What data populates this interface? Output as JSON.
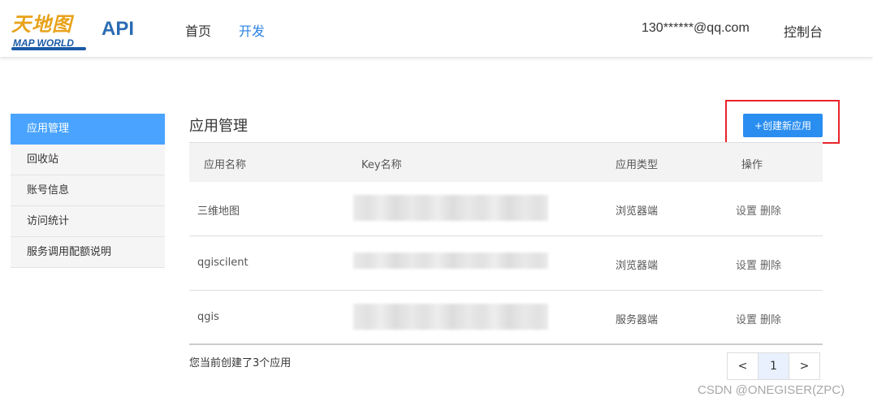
{
  "header": {
    "logo_cn": "天地图",
    "logo_en": "MAP WORLD",
    "api_label": "API",
    "nav": [
      {
        "label": "首页",
        "active": false
      },
      {
        "label": "开发",
        "active": true
      }
    ],
    "user_email": "130******@qq.com",
    "console_label": "控制台"
  },
  "sidebar": {
    "items": [
      {
        "label": "应用管理",
        "active": true
      },
      {
        "label": "回收站",
        "active": false
      },
      {
        "label": "账号信息",
        "active": false
      },
      {
        "label": "访问统计",
        "active": false
      },
      {
        "label": "服务调用配额说明",
        "active": false
      }
    ]
  },
  "main": {
    "title": "应用管理",
    "create_button": "+创建新应用",
    "table": {
      "headers": {
        "name": "应用名称",
        "key": "Key名称",
        "type": "应用类型",
        "ops": "操作"
      },
      "rows": [
        {
          "name": "三维地图",
          "type": "浏览器端",
          "op_settings": "设置",
          "op_delete": "删除"
        },
        {
          "name": "qgiscilent",
          "type": "浏览器端",
          "op_settings": "设置",
          "op_delete": "删除"
        },
        {
          "name": "qgis",
          "type": "服务器端",
          "op_settings": "设置",
          "op_delete": "删除"
        }
      ]
    },
    "summary": "您当前创建了3个应用",
    "pagination": {
      "prev": "<",
      "current": "1",
      "next": ">"
    }
  },
  "watermark": "CSDN @ONEGISER(ZPC)",
  "colors": {
    "accent": "#2a8ef0",
    "sidebar_active": "#4aa4ff",
    "highlight_border": "#e8242a",
    "brand_orange": "#e8a21a",
    "brand_blue": "#1b5aa6"
  }
}
